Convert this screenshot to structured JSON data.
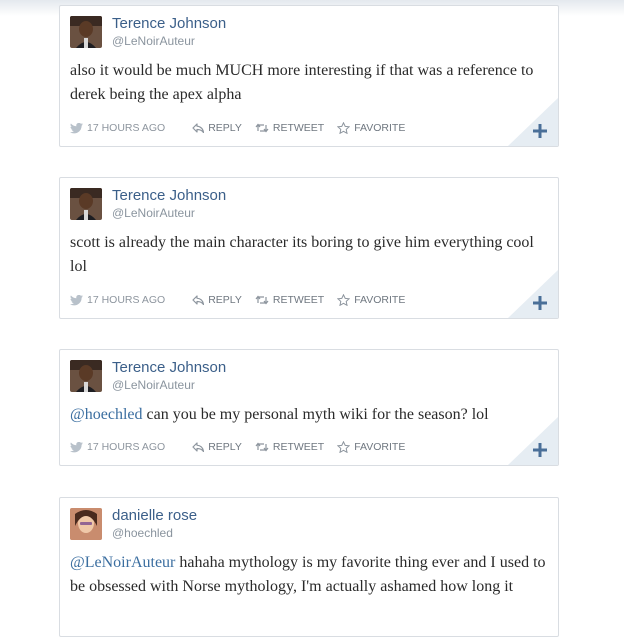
{
  "tweets": [
    {
      "name": "Terence Johnson",
      "handle": "@LeNoirAuteur",
      "avatar": "terence-avatar",
      "text_parts": [
        "",
        "also it would be much MUCH more interesting if that was a reference to derek being the apex alpha"
      ],
      "mention": "",
      "time": "17 HOURS AGO",
      "reply": "REPLY",
      "retweet": "RETWEET",
      "favorite": "FAVORITE"
    },
    {
      "name": "Terence Johnson",
      "handle": "@LeNoirAuteur",
      "avatar": "terence-avatar",
      "text_parts": [
        "",
        "scott is already the main character its boring to give him everything cool lol"
      ],
      "mention": "",
      "time": "17 HOURS AGO",
      "reply": "REPLY",
      "retweet": "RETWEET",
      "favorite": "FAVORITE"
    },
    {
      "name": "Terence Johnson",
      "handle": "@LeNoirAuteur",
      "avatar": "terence-avatar",
      "mention": "@hoechled",
      "rest": " can you be my personal myth wiki for the season? lol",
      "time": "17 HOURS AGO",
      "reply": "REPLY",
      "retweet": "RETWEET",
      "favorite": "FAVORITE"
    },
    {
      "name": "danielle rose",
      "handle": "@hoechled",
      "avatar": "danielle-avatar",
      "mention": "@LeNoirAuteur",
      "rest": " hahaha mythology is my favorite thing ever and I used to be obsessed with Norse mythology, I'm actually ashamed how long it"
    }
  ],
  "colors": {
    "link": "#3b6ea0",
    "name": "#3b5f89",
    "plus": "#4a6f98"
  },
  "icons": [
    "bird-icon",
    "reply-icon",
    "retweet-icon",
    "star-icon",
    "plus-icon"
  ]
}
